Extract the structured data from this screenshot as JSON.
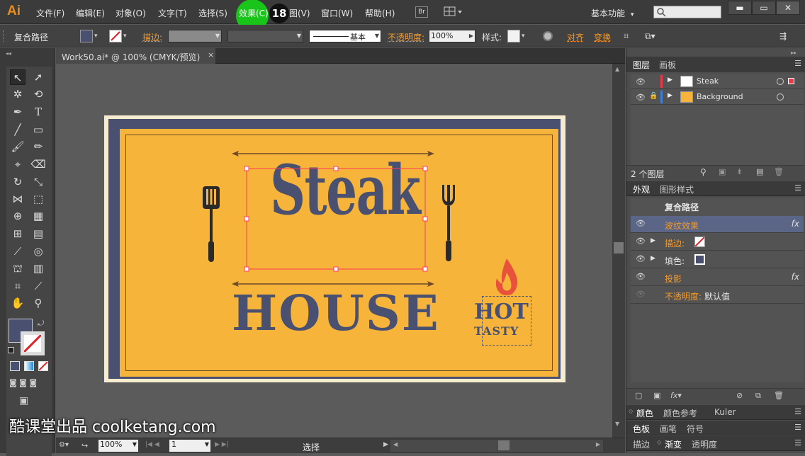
{
  "app": {
    "logo": "Ai"
  },
  "menubar": {
    "items": [
      "文件(F)",
      "编辑(E)",
      "对象(O)",
      "文字(T)",
      "选择(S)",
      "效果(C)",
      "视图(V)",
      "窗口(W)",
      "帮助(H)"
    ],
    "view_suffix": "图(V)",
    "step_badge": "18",
    "bridge_label": "Br",
    "workspace_label": "基本功能",
    "colors": {
      "highlight": "#19c519",
      "logo": "#e88d1a"
    }
  },
  "controlbar": {
    "selection_label": "复合路径",
    "stroke_label": "描边:",
    "stroke_style_label": "基本",
    "opacity_label": "不透明度:",
    "opacity_value": "100%",
    "style_label": "样式:",
    "align_label": "对齐",
    "transform_label": "变换"
  },
  "document": {
    "tab_title": "Work50.ai* @ 100% (CMYK/预览)",
    "close_glyph": "×"
  },
  "artwork": {
    "title": "Steak",
    "subtitle": "HOUSE",
    "badge_top": "HOT",
    "badge_bottom": "TASTY",
    "colors": {
      "navy": "#4a5170",
      "orange": "#f6b43a",
      "selection": "#ff3b5c"
    }
  },
  "statusbar": {
    "zoom": "100%",
    "page": "1",
    "tool_status": "选择"
  },
  "layers_panel": {
    "tabs": [
      "图层",
      "画板"
    ],
    "layers": [
      {
        "name": "Steak",
        "color": "#e8394a"
      },
      {
        "name": "Background",
        "color": "#3c7fd6"
      }
    ],
    "footer_count": "2 个图层"
  },
  "appearance_panel": {
    "tabs": [
      "外观",
      "图形样式"
    ],
    "header": "复合路径",
    "rows": [
      {
        "label": "波纹效果",
        "orange": true,
        "fx": true,
        "selected": true
      },
      {
        "label": "描边:",
        "orange": true,
        "fx": false
      },
      {
        "label": "填色:",
        "orange": false,
        "fx": false
      },
      {
        "label": "投影",
        "orange": true,
        "fx": true
      },
      {
        "label": "不透明度:",
        "orange": true,
        "value": "默认值"
      }
    ]
  },
  "bottom_panels": {
    "row1": [
      "颜色",
      "颜色参考",
      "Kuler"
    ],
    "row2": [
      "色板",
      "画笔",
      "符号"
    ],
    "row3": [
      "描边",
      "渐变",
      "透明度"
    ]
  },
  "watermark": "酷课堂出品 coolketang.com"
}
